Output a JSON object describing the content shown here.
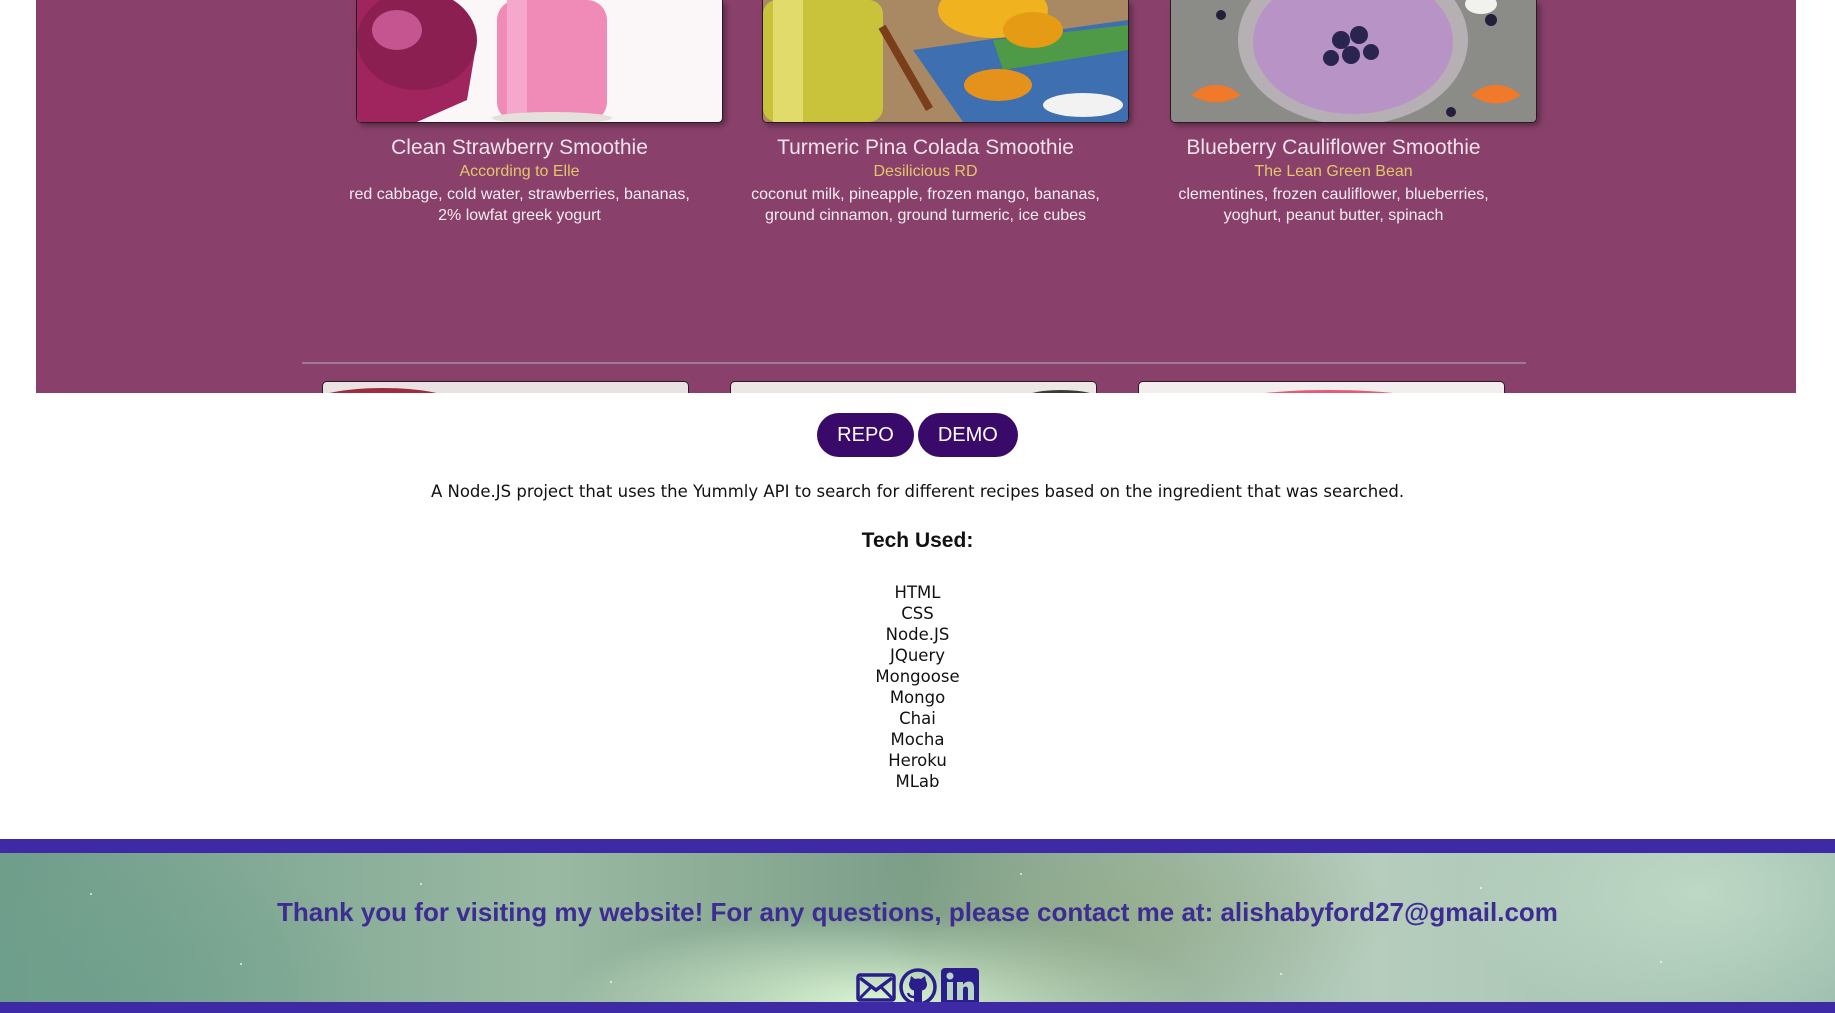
{
  "preview": {
    "cards": [
      {
        "title": "Clean Strawberry Smoothie",
        "source": "According to Elle",
        "ingredients_line1": "red cabbage, cold water, strawberries, bananas,",
        "ingredients_line2": "2% lowfat greek yogurt"
      },
      {
        "title": "Turmeric Pina Colada Smoothie",
        "source": "Desilicious RD",
        "ingredients_line1": "coconut milk, pineapple, frozen mango, bananas,",
        "ingredients_line2": "ground cinnamon, ground turmeric, ice cubes"
      },
      {
        "title": "Blueberry Cauliflower Smoothie",
        "source": "The Lean Green Bean",
        "ingredients_line1": "clementines, frozen cauliflower, blueberries,",
        "ingredients_line2": "yoghurt, peanut butter, spinach"
      }
    ]
  },
  "buttons": {
    "repo_label": "REPO",
    "demo_label": "DEMO"
  },
  "project": {
    "description": "A Node.JS project that uses the Yummly API to search for different recipes based on the ingredient that was searched.",
    "tech_heading": "Tech Used:",
    "tech": [
      "HTML",
      "CSS",
      "Node.JS",
      "JQuery",
      "Mongoose",
      "Mongo",
      "Chai",
      "Mocha",
      "Heroku",
      "MLab"
    ]
  },
  "footer": {
    "thanks": "Thank you for visiting my website! For any questions, please contact me at: alishabyford27@gmail.com",
    "icons": [
      "mail-icon",
      "github-icon",
      "linkedin-icon"
    ]
  },
  "colors": {
    "panel_bg": "#89416b",
    "button_bg": "#3a0a6b",
    "footer_band": "#3f2aa6",
    "footer_text": "#3d2c92",
    "source_text": "#e2c76a"
  }
}
